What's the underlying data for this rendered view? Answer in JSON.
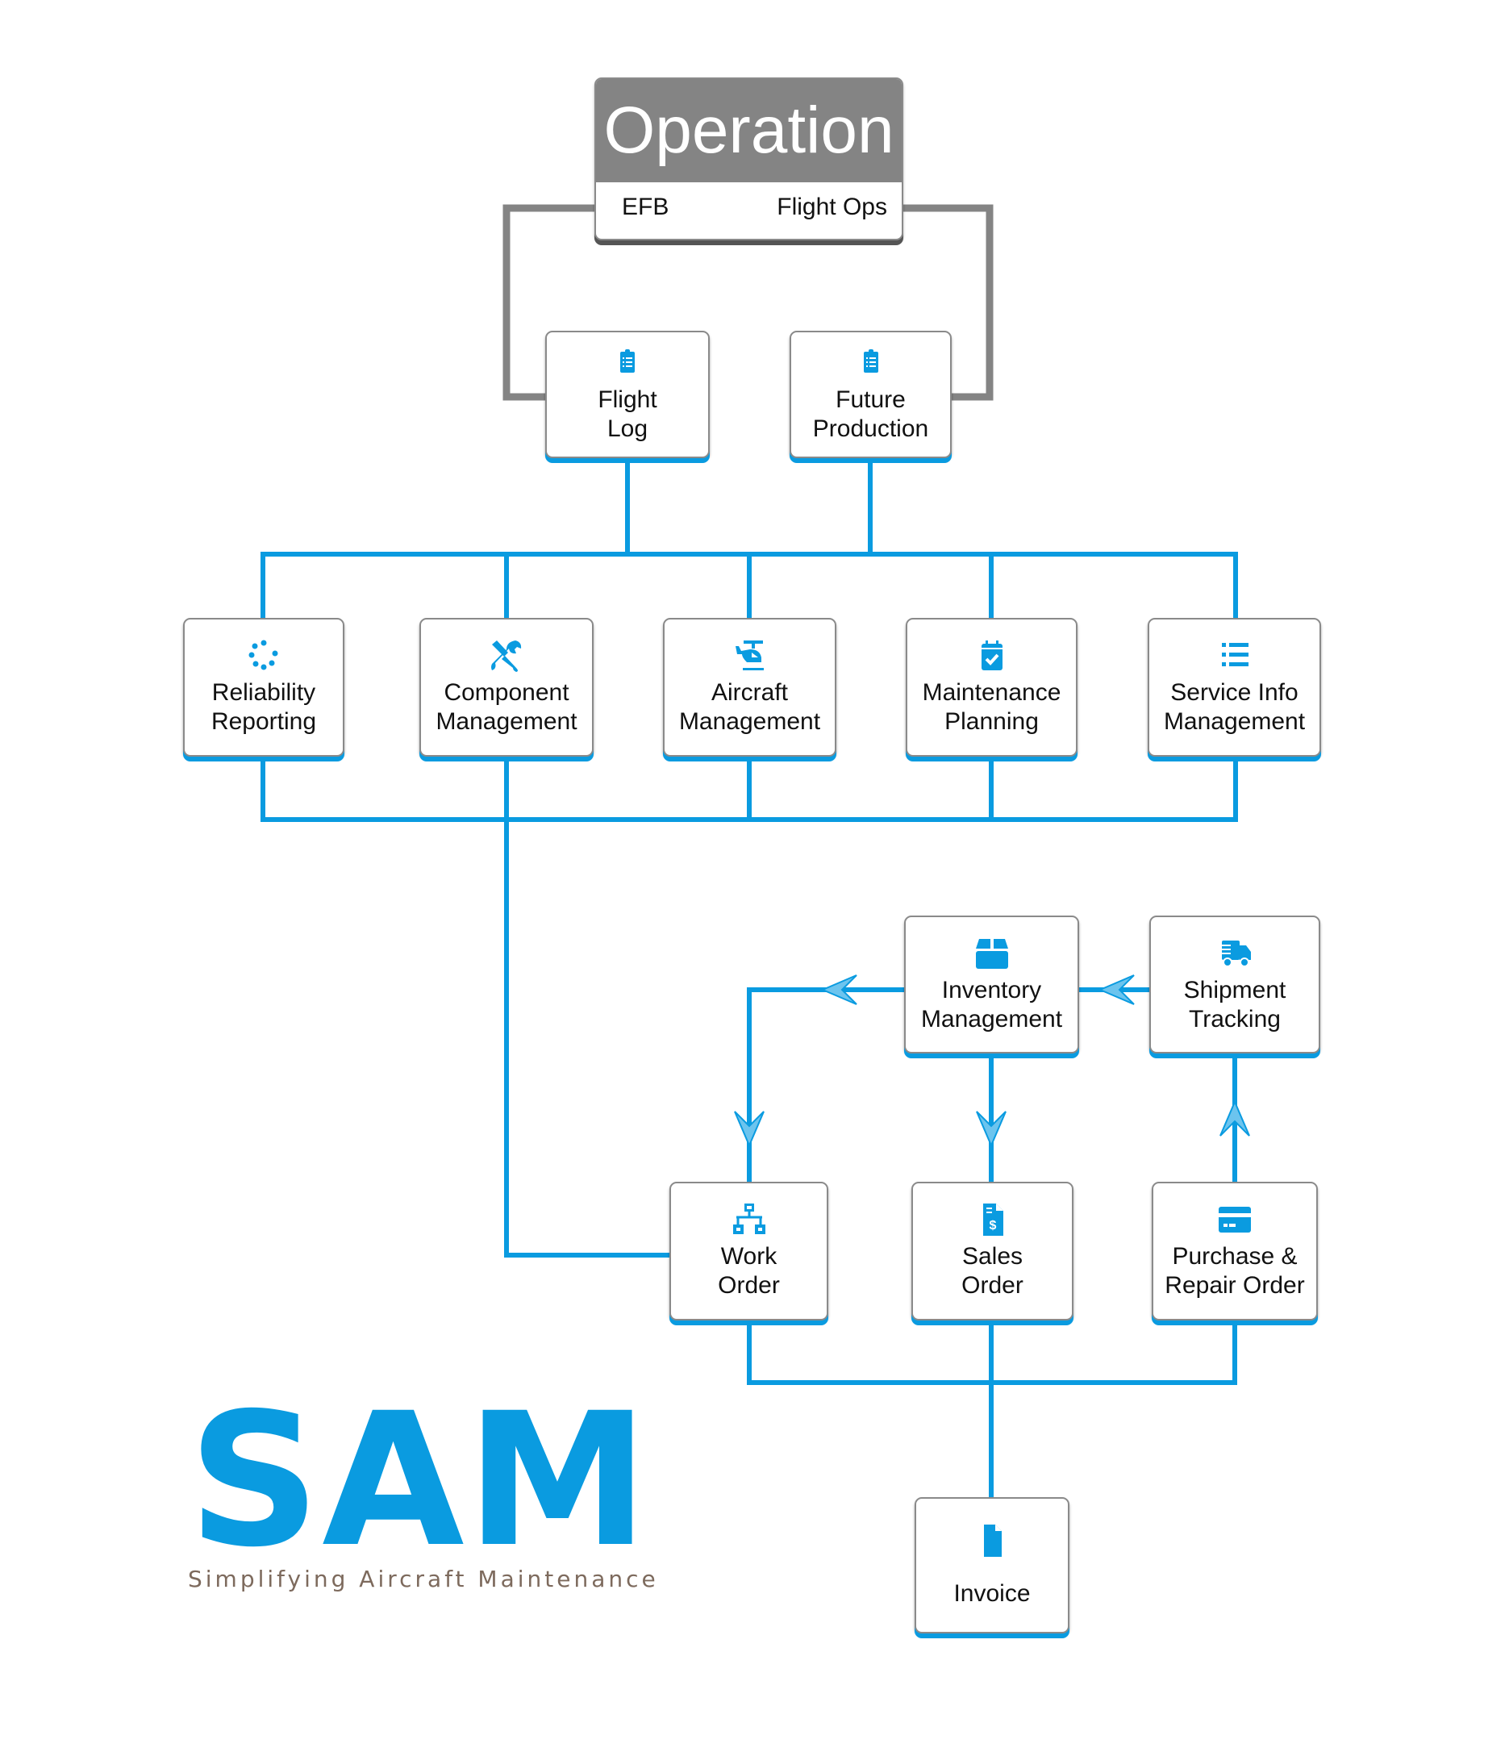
{
  "colors": {
    "accent": "#0a9be0",
    "gray": "#848484",
    "tagline": "#7d6a5d"
  },
  "operation": {
    "title": "Operation",
    "left": "EFB",
    "right": "Flight Ops"
  },
  "nodes": {
    "flight_log": {
      "label": "Flight\nLog",
      "icon": "clipboard-list-icon"
    },
    "future_production": {
      "label": "Future\nProduction",
      "icon": "clipboard-list-icon"
    },
    "reliability_reporting": {
      "label": "Reliability\nReporting",
      "icon": "spinner-dots-icon"
    },
    "component_management": {
      "label": "Component\nManagement",
      "icon": "tools-icon"
    },
    "aircraft_management": {
      "label": "Aircraft\nManagement",
      "icon": "helicopter-icon"
    },
    "maintenance_planning": {
      "label": "Maintenance\nPlanning",
      "icon": "calendar-check-icon"
    },
    "service_info_management": {
      "label": "Service Info\nManagement",
      "icon": "list-icon"
    },
    "inventory_management": {
      "label": "Inventory\nManagement",
      "icon": "box-icon"
    },
    "shipment_tracking": {
      "label": "Shipment\nTracking",
      "icon": "shipping-truck-icon"
    },
    "work_order": {
      "label": "Work\nOrder",
      "icon": "sitemap-icon"
    },
    "sales_order": {
      "label": "Sales\nOrder",
      "icon": "invoice-dollar-icon"
    },
    "purchase_repair_order": {
      "label": "Purchase &\nRepair Order",
      "icon": "credit-card-icon"
    },
    "invoice": {
      "label": "Invoice",
      "icon": "file-icon"
    }
  },
  "logo": {
    "name": "SAM",
    "tagline": "Simplifying Aircraft Maintenance"
  }
}
